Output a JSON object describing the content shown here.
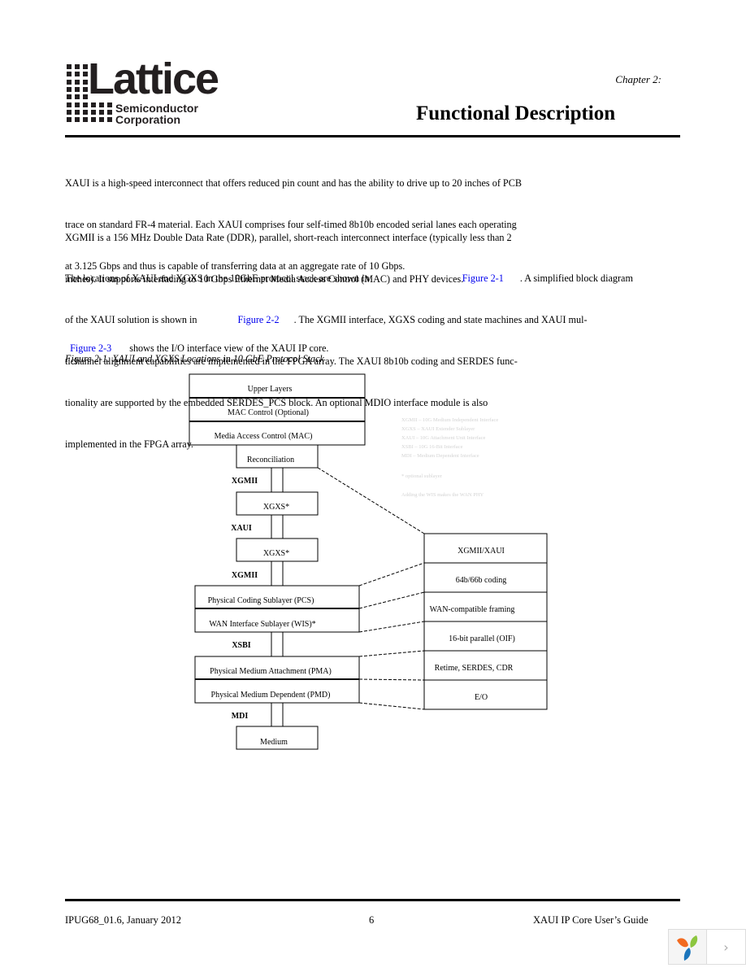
{
  "header": {
    "logo": {
      "wordmark": "Lattice",
      "registered": "®",
      "line1": "Semiconductor",
      "line2": "Corporation"
    },
    "chapter": "Chapter 2:",
    "title": "Functional Description"
  },
  "body": {
    "p1": [
      "XAUI is a high-speed interconnect that offers reduced pin count and has the ability to drive up to 20 inches of PCB",
      "trace on standard FR-4 material. Each XAUI comprises four self-timed 8b10b encoded serial lanes each operating",
      "at 3.125 Gbps and thus is capable of transferring data at an aggregate rate of 10 Gbps."
    ],
    "p2": [
      "XGMII is a 156 MHz Double Data Rate (DDR), parallel, short-reach interconnect interface (typically less than 2",
      "inches). It supports interfacing to 10 Gbps Ethernet Media Access Control (MAC) and PHY devices."
    ],
    "p3": {
      "l1_pre": "The locations of XAUI and XGXS in the 10GbE protocol stack are shown in",
      "l1_link": "Figure 2-1",
      "l1_post": ". A simplified block diagram",
      "l2_pre": "of the XAUI solution is shown in",
      "l2_link": "Figure 2-2",
      "l2_post": ". The XGMII interface, XGXS coding and state machines and XAUI mul-",
      "l3": "tichannel alignment capabilities are implemented in the FPGA array. The XAUI 8b10b coding and SERDES func-",
      "l4": "tionality are supported by the embedded SERDES_PCS block. An optional MDIO interface module is also",
      "l5": "implemented in the FPGA array."
    },
    "p4": {
      "link": "Figure 2-3",
      "text": "shows the I/O interface view of the XAUI IP core."
    },
    "figure_caption": "Figure 2-1. XAUI and XGXS Locations in 10 GbE Protocol Stack"
  },
  "diagram": {
    "stack": {
      "upper_layers": "Upper Layers",
      "mac_control": "MAC Control (Optional)",
      "mac": "Media Access Control (MAC)",
      "reconciliation": "Reconciliation",
      "xgxs_top": "XGXS*",
      "xgxs_bottom": "XGXS*",
      "pcs": "Physical Coding Sublayer (PCS)",
      "wis": "WAN Interface Sublayer (WIS)*",
      "pma": "Physical Medium Attachment (PMA)",
      "pmd": "Physical Medium Dependent (PMD)",
      "medium": "Medium"
    },
    "interfaces": {
      "xgmii_top": "XGMII",
      "xaui": "XAUI",
      "xgmii_bottom": "XGMII",
      "xsbi": "XSBI",
      "mdi": "MDI"
    },
    "detail": [
      "XGMII/XAUI",
      "64b/66b coding",
      "WAN-compatible framing",
      "16-bit parallel (OIF)",
      "Retime, SERDES, CDR",
      "E/O"
    ],
    "legend": [
      "XGMII – 10G Medium Independent Interface",
      "XGXS – XAUI Extender Sublayer",
      "XAUI – 10G Attachment Unit Interface",
      "XSBI – 10G 16-Bit Interface",
      "MDI – Medium Dependent Interface"
    ],
    "legend_note1": "* optional sublayer",
    "legend_note2": "Adding the WIS makes the WAN PHY"
  },
  "footer": {
    "doc_id": "IPUG68_01.6, January 2012",
    "page_number": "6",
    "doc_title": "XAUI IP Core User’s Guide"
  },
  "viewer": {
    "next_label": "›",
    "colors": {
      "orange": "#f26b21",
      "green": "#8cc63f",
      "blue": "#1b75bc"
    }
  }
}
